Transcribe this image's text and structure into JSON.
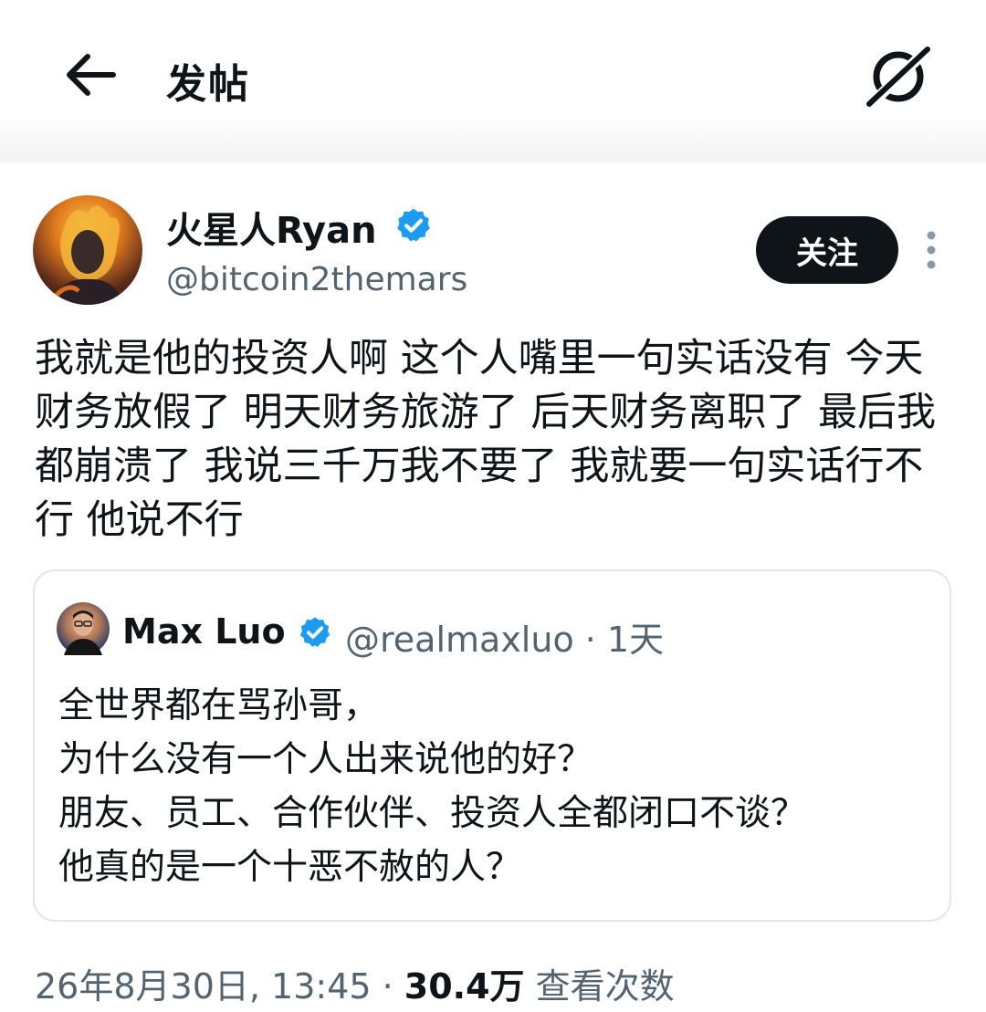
{
  "header": {
    "title": "发帖"
  },
  "post": {
    "author": {
      "name": "火星人Ryan",
      "handle": "@bitcoin2themars"
    },
    "follow_label": "关注",
    "text": "我就是他的投资人啊 这个人嘴里一句实话没有 今天财务放假了 明天财务旅游了 后天财务离职了 最后我都崩溃了 我说三千万我不要了 我就要一句实话行不行 他说不行",
    "quote": {
      "author": {
        "name": "Max Luo",
        "handle_meta": "@realmaxluo · 1天"
      },
      "text": "全世界都在骂孙哥，\n为什么没有一个人出来说他的好？\n朋友、员工、合作伙伴、投资人全都闭口不谈？\n他真的是一个十恶不赦的人？"
    },
    "timestamp": "26年8月30日, 13:45 · ",
    "views_count": "30.4万",
    "views_label": " 查看次数"
  },
  "colors": {
    "verified": "#1d9bf0",
    "text_primary": "#0f1419",
    "text_secondary": "#536471",
    "border": "#e3e6e8"
  },
  "icons": {
    "back": "arrow-left-icon",
    "grok": "grok-icon",
    "verified": "verified-badge-icon",
    "more": "more-vertical-icon"
  }
}
